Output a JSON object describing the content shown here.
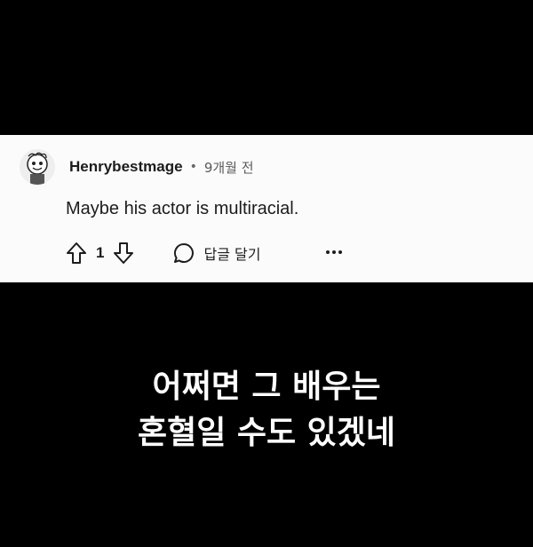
{
  "comment": {
    "author": "Henrybestmage",
    "separator": "•",
    "time": "9개월 전",
    "text": "Maybe his actor is multiracial.",
    "votes": "1",
    "reply_label": "답글 달기",
    "icons": {
      "avatar": "snoo-avatar-icon",
      "upvote": "arrow-up-icon",
      "downvote": "arrow-down-icon",
      "reply": "speech-bubble-icon",
      "more": "more-dots-icon"
    }
  },
  "subtitle": {
    "line1": "어쩌면 그 배우는",
    "line2": "혼혈일 수도 있겠네"
  }
}
